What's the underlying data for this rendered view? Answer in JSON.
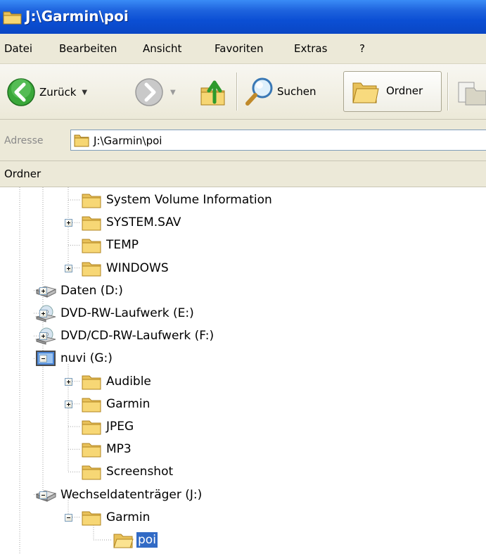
{
  "window": {
    "title": "J:\\Garmin\\poi",
    "title_icon": "folder-icon"
  },
  "menu": {
    "items": [
      "Datei",
      "Bearbeiten",
      "Ansicht",
      "Favoriten",
      "Extras",
      "?"
    ]
  },
  "toolbar": {
    "back_label": "Zurück",
    "search_label": "Suchen",
    "folders_label": "Ordner",
    "icons": [
      "back-arrow-icon",
      "forward-arrow-icon",
      "up-folder-icon",
      "search-icon",
      "folders-icon",
      "folder-copy-icon"
    ]
  },
  "address": {
    "label": "Adresse",
    "value": "J:\\Garmin\\poi"
  },
  "folder_pane": {
    "title": "Ordner"
  },
  "tree": {
    "items": [
      {
        "label": "System Volume Information",
        "icon": "folder-icon",
        "depth": 2,
        "expander": "none"
      },
      {
        "label": "SYSTEM.SAV",
        "icon": "folder-icon",
        "depth": 2,
        "expander": "plus"
      },
      {
        "label": "TEMP",
        "icon": "folder-icon",
        "depth": 2,
        "expander": "none"
      },
      {
        "label": "WINDOWS",
        "icon": "folder-icon",
        "depth": 2,
        "expander": "plus"
      },
      {
        "label": "Daten (D:)",
        "icon": "hard-drive-icon",
        "depth": 1,
        "expander": "plus"
      },
      {
        "label": "DVD-RW-Laufwerk (E:)",
        "icon": "dvd-drive-icon",
        "depth": 1,
        "expander": "plus"
      },
      {
        "label": "DVD/CD-RW-Laufwerk (F:)",
        "icon": "dvd-drive-icon",
        "depth": 1,
        "expander": "plus"
      },
      {
        "label": "nuvi (G:)",
        "icon": "device-icon",
        "depth": 1,
        "expander": "minus"
      },
      {
        "label": "Audible",
        "icon": "folder-icon",
        "depth": 2,
        "expander": "plus"
      },
      {
        "label": "Garmin",
        "icon": "folder-icon",
        "depth": 2,
        "expander": "plus"
      },
      {
        "label": "JPEG",
        "icon": "folder-icon",
        "depth": 2,
        "expander": "none"
      },
      {
        "label": "MP3",
        "icon": "folder-icon",
        "depth": 2,
        "expander": "none"
      },
      {
        "label": "Screenshot",
        "icon": "folder-icon",
        "depth": 2,
        "expander": "none"
      },
      {
        "label": "Wechseldatenträger (J:)",
        "icon": "removable-drive-icon",
        "depth": 1,
        "expander": "minus"
      },
      {
        "label": "Garmin",
        "icon": "folder-icon",
        "depth": 2,
        "expander": "minus"
      },
      {
        "label": "poi",
        "icon": "open-folder-icon",
        "depth": 3,
        "expander": "none",
        "selected": true
      }
    ]
  },
  "colors": {
    "titlebar": "#0b4fd4",
    "chrome": "#ece9d8",
    "selection": "#316ac5"
  }
}
